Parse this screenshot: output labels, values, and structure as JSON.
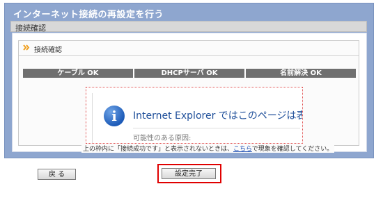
{
  "window": {
    "title": "インターネット接続の再設定を行う"
  },
  "section": {
    "title": "接続確認"
  },
  "panel": {
    "label": "接続確認"
  },
  "status": {
    "items": [
      {
        "label": "ケーブル OK"
      },
      {
        "label": "DHCPサーバ OK"
      },
      {
        "label": "名前解決 OK"
      }
    ]
  },
  "frame": {
    "message": "Internet Explorer ではこのページは表",
    "cause": "可能性のある原因:"
  },
  "note": {
    "before": "上の枠内に「接続成功です」と表示されないときは、",
    "link": "こちら",
    "after": "で現象を確認してください。"
  },
  "buttons": {
    "back": "戻 る",
    "done": "設定完了"
  },
  "colors": {
    "frame_bg": "#8ea6cf",
    "status_bar": "#6f6f6f",
    "highlight": "#e00000"
  }
}
